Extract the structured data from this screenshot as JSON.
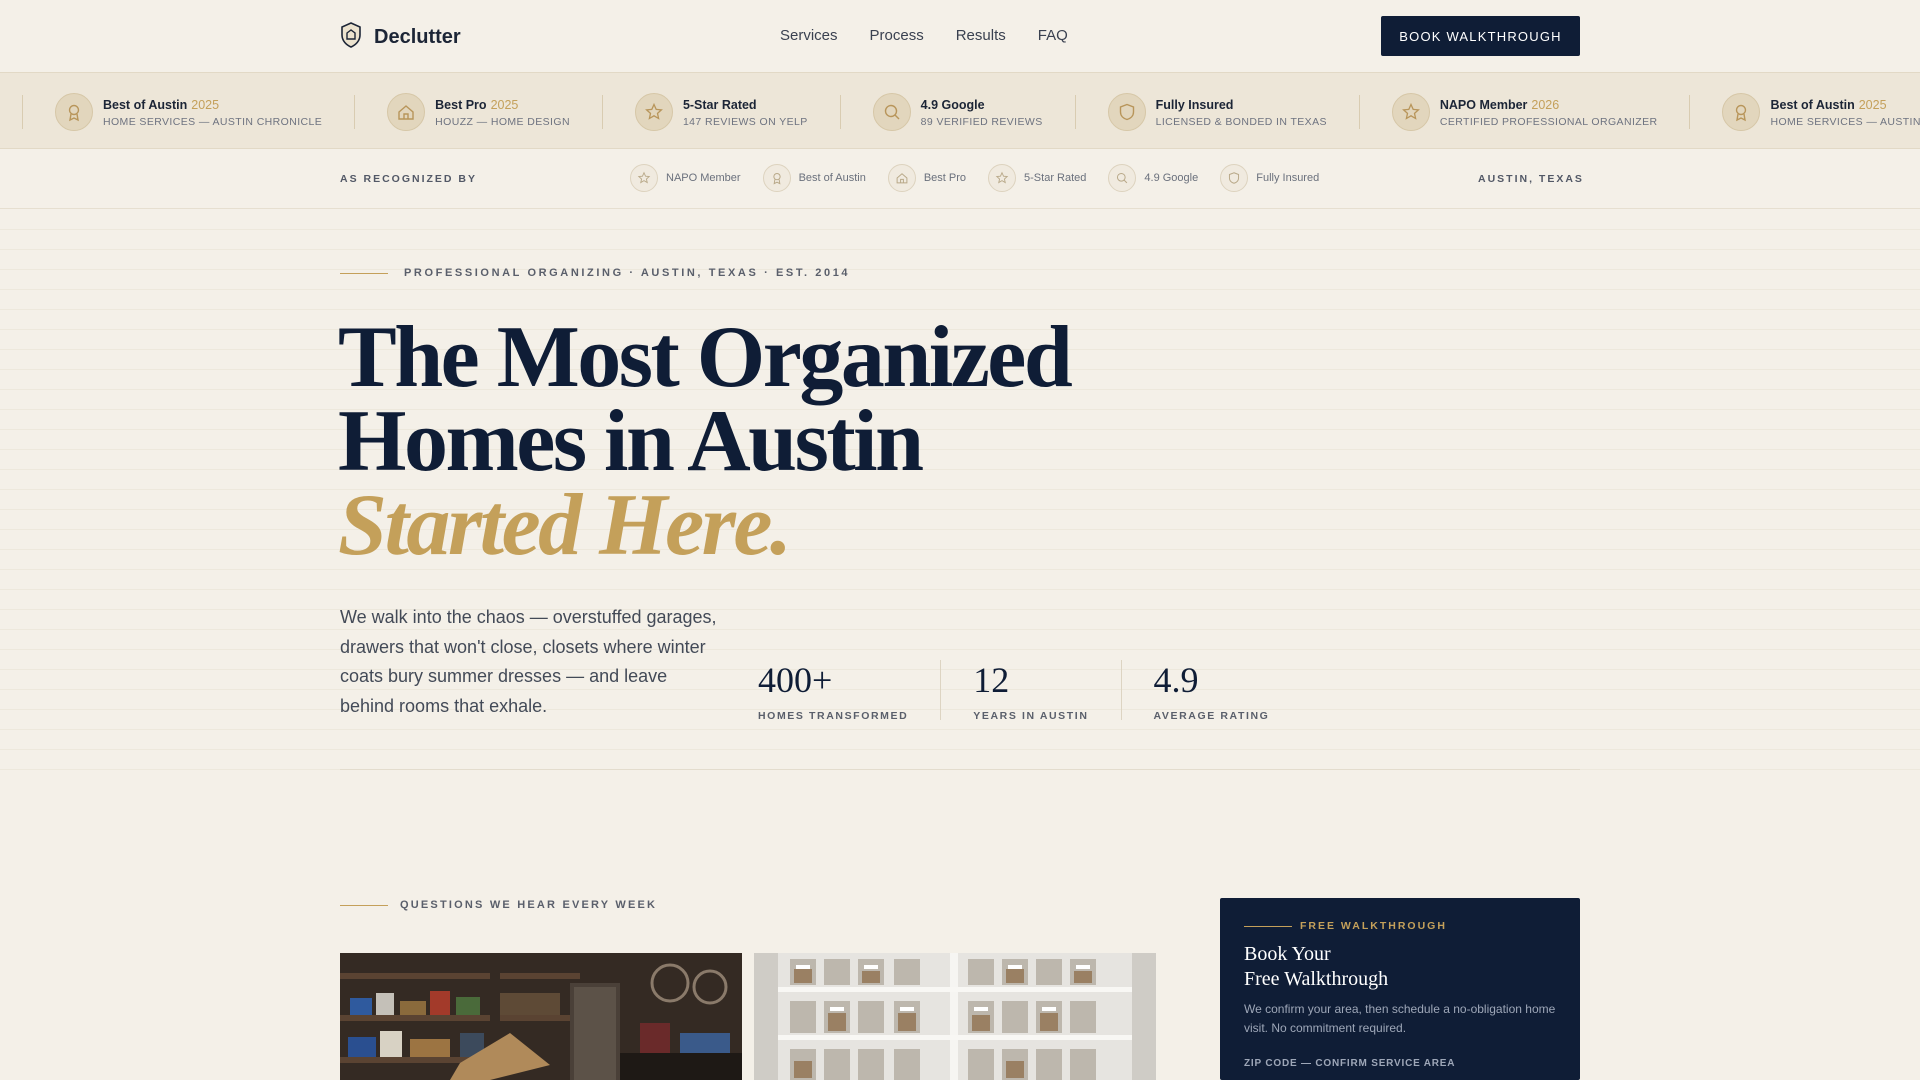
{
  "header": {
    "brand": "Declutter",
    "nav": [
      "Services",
      "Process",
      "Results",
      "FAQ"
    ],
    "cta": "BOOK WALKTHROUGH"
  },
  "awards": [
    {
      "icon": "ribbon-icon",
      "title": "Best of Austin",
      "year": "2025",
      "sub": "HOME SERVICES — AUSTIN CHRONICLE"
    },
    {
      "icon": "house-icon",
      "title": "Best Pro",
      "year": "2025",
      "sub": "HOUZZ — HOME DESIGN"
    },
    {
      "icon": "star-icon",
      "title": "5-Star Rated",
      "year": "",
      "sub": "147 REVIEWS ON YELP"
    },
    {
      "icon": "search-icon",
      "title": "4.9 Google",
      "year": "",
      "sub": "89 VERIFIED REVIEWS"
    },
    {
      "icon": "shield-icon",
      "title": "Fully Insured",
      "year": "",
      "sub": "LICENSED & BONDED IN TEXAS"
    },
    {
      "icon": "star-icon",
      "title": "NAPO Member",
      "year": "2026",
      "sub": "CERTIFIED PROFESSIONAL ORGANIZER"
    },
    {
      "icon": "ribbon-icon",
      "title": "Best of Austin",
      "year": "2025",
      "sub": "HOME SERVICES — AUSTIN CHRONICLE"
    }
  ],
  "recognized": {
    "label": "AS RECOGNIZED BY",
    "items": [
      {
        "icon": "star-icon",
        "text": "NAPO Member"
      },
      {
        "icon": "ribbon-icon",
        "text": "Best of Austin"
      },
      {
        "icon": "house-icon",
        "text": "Best Pro"
      },
      {
        "icon": "star-icon",
        "text": "5-Star Rated"
      },
      {
        "icon": "search-icon",
        "text": "4.9 Google"
      },
      {
        "icon": "shield-icon",
        "text": "Fully Insured"
      }
    ],
    "location": "AUSTIN, TEXAS"
  },
  "hero": {
    "eyebrow": "PROFESSIONAL ORGANIZING · AUSTIN, TEXAS · EST. 2014",
    "line1": "The Most Organized",
    "line2": "Homes in Austin",
    "line3": "Started Here.",
    "lead": "We walk into the chaos — overstuffed garages, drawers that won't close, closets where winter coats bury summer dresses — and leave behind rooms that exhale.",
    "stats": [
      {
        "num": "400+",
        "label": "HOMES TRANSFORMED"
      },
      {
        "num": "12",
        "label": "YEARS IN AUSTIN"
      },
      {
        "num": "4.9",
        "label": "AVERAGE RATING"
      }
    ]
  },
  "questions": {
    "eyebrow": "QUESTIONS WE HEAR EVERY WEEK"
  },
  "walkthrough": {
    "eyebrow": "FREE WALKTHROUGH",
    "title_line1": "Book Your",
    "title_line2": "Free Walkthrough",
    "desc": "We confirm your area, then schedule a no-obligation home visit. No commitment required.",
    "zip_label": "ZIP CODE — CONFIRM SERVICE AREA"
  },
  "colors": {
    "navy": "#0f1d36",
    "gold": "#c4a05a",
    "cream": "#f4f0e8"
  }
}
